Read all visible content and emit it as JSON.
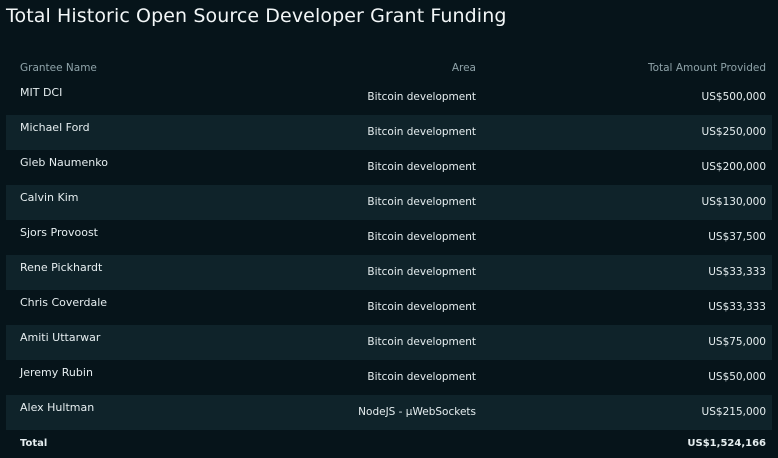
{
  "title": "Total Historic Open Source Developer Grant Funding",
  "table": {
    "headers": {
      "name": "Grantee Name",
      "area": "Area",
      "amount": "Total Amount Provided"
    },
    "rows": [
      {
        "name": "MIT DCI",
        "area": "Bitcoin development",
        "amount": "US$500,000"
      },
      {
        "name": "Michael Ford",
        "area": "Bitcoin development",
        "amount": "US$250,000"
      },
      {
        "name": "Gleb Naumenko",
        "area": "Bitcoin development",
        "amount": "US$200,000"
      },
      {
        "name": "Calvin Kim",
        "area": "Bitcoin development",
        "amount": "US$130,000"
      },
      {
        "name": "Sjors Provoost",
        "area": "Bitcoin development",
        "amount": "US$37,500"
      },
      {
        "name": "Rene Pickhardt",
        "area": "Bitcoin development",
        "amount": "US$33,333"
      },
      {
        "name": "Chris Coverdale",
        "area": "Bitcoin development",
        "amount": "US$33,333"
      },
      {
        "name": "Amiti Uttarwar",
        "area": "Bitcoin development",
        "amount": "US$75,000"
      },
      {
        "name": "Jeremy Rubin",
        "area": "Bitcoin development",
        "amount": "US$50,000"
      },
      {
        "name": "Alex Hultman",
        "area": "NodeJS - µWebSockets",
        "amount": "US$215,000"
      }
    ],
    "total": {
      "label": "Total",
      "amount": "US$1,524,166"
    }
  }
}
